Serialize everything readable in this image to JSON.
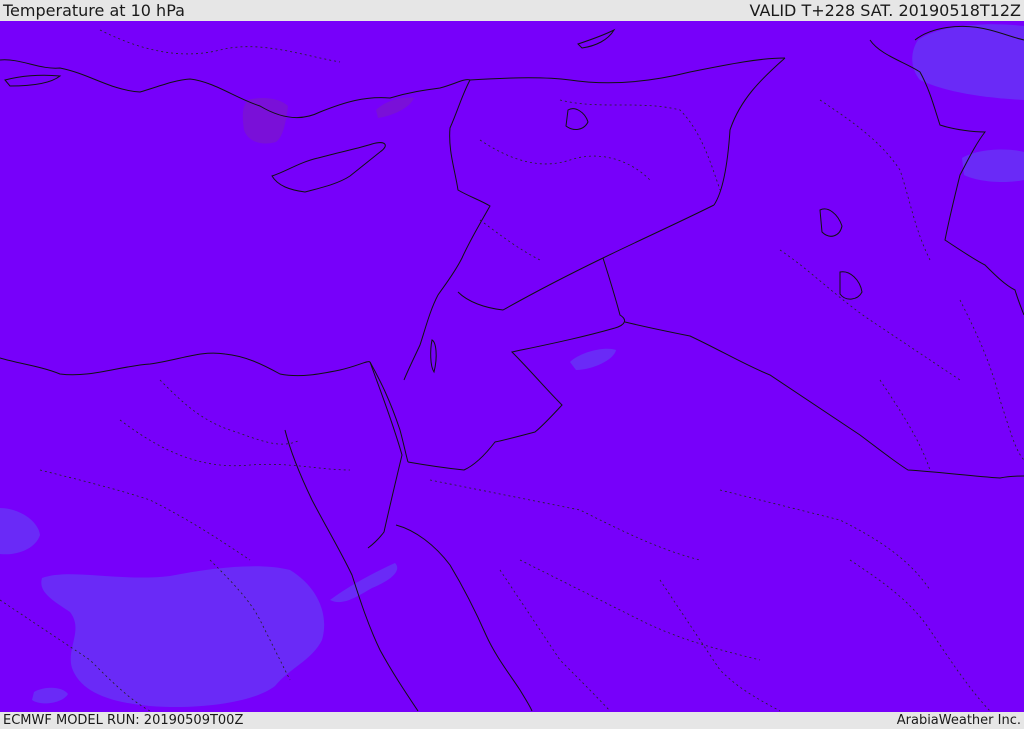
{
  "header": {
    "title": "Temperature at 10 hPa",
    "valid": "VALID T+228 SAT. 20190518T12Z"
  },
  "footer": {
    "model_run": "ECMWF MODEL RUN: 20190509T00Z",
    "credit": "ArabiaWeather Inc."
  },
  "map": {
    "base_color": "#7700fa",
    "cooler_color": "#6a2af7",
    "warmer_color": "#7a10d8",
    "border_color": "#111111"
  }
}
